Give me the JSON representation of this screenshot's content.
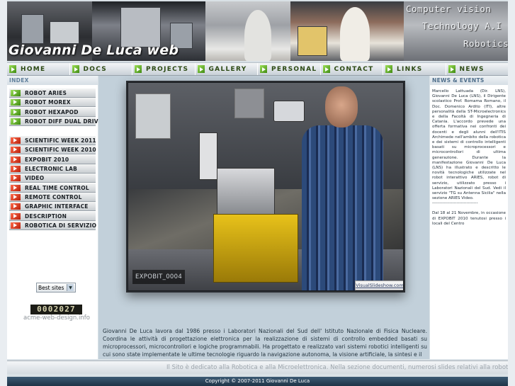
{
  "header": {
    "site_title": "Giovanni De Luca web",
    "banner_text": [
      "Computer vision",
      "Technology A.I",
      "Robotics"
    ]
  },
  "nav": {
    "items": [
      "HOME",
      "DOCS",
      "PROJECTS",
      "GALLERY",
      "PERSONAL",
      "CONTACT",
      "LINKS",
      "NEWS"
    ]
  },
  "sidebar": {
    "title": "INDEX",
    "robot_items": [
      "ROBOT ARIES",
      "ROBOT MOREX",
      "ROBOT HEXAPOD",
      "ROBOT DIFF DUAL DRIVE"
    ],
    "section_items": [
      "SCIENTIFIC WEEK 2011",
      "SCIENTIFIC WEEK 2010",
      "EXPOBIT 2010",
      "ELECTRONIC LAB",
      "VIDEO",
      "REAL TIME CONTROL",
      "REMOTE CONTROL",
      "GRAPHIC INTERFACE",
      "DESCRIPTION",
      "ROBOTICA DI SERVIZIO"
    ],
    "best_sites_label": "Best sites",
    "counter_value": "0002027",
    "counter_caption": "acme-web-design.info"
  },
  "main": {
    "photo_caption": "EXPOBIT_0004",
    "slideshow_credit": "VisualSlideshow.com",
    "intro_text": "Giovanni De Luca lavora dal 1986 presso i Laboratori Nazionali del Sud dell' Istituto Nazionale di Fisica Nucleare. Coordina le attività di progettazione elettronica per la realizzazione di sistemi di controllo embedded basati su microprocessori, microcontrollori e logiche programmabili. Ha progettato e realizzato vari sistemi robotici intelligenti su cui sono state implementate le ultime tecnologie riguardo la navigazione autonoma, la visione artificiale, la sintesi e il"
  },
  "news": {
    "title": "NEWS & EVENTS",
    "paragraph1": "Marcello Lattuada (Dir. LNS), Giovanni De Luca (LNS), il Dirigente scolastico Prof. Romama Romano, il Doc. Domenico Ardito (ITI), altre personalità della ST-Microelectronics e della Facoltà di Ingegneria di Catania. L'accordo prevede una offerta formativa nei confronti dei docenti e degli alunni dell'ITIS Archimede nell'ambito della robotica e dei sistemi di controllo intelligenti basati su microprocessori e microcontrollori di ultima generazione. Durante la manifestazione Giovanni De Luca (LNS) ha illustrato e descritto le novità tecnologiche utilizzate nel robot interattivo ARIES, robot di servizio, utilizzato presso i Laboratori Nazionali del Sud. Vedi il servizio \"TG su Antenna Sicilia\" nella sezione ARIES Video.",
    "separator": "--------------------------------",
    "paragraph2": "Dal 18 al 21 Novembre, in occasione di EXPOBIT 2010 tenutosi presso i locali del Centro"
  },
  "footer": {
    "marquee_text": "Il Sito è dedicato alla Robotica e alla Microelettronica. Nella sezione documenti, numerosi slides relativi alla robotica mobile",
    "copyright": "Copyright © 2007-2011 Giovanni De Luca"
  }
}
